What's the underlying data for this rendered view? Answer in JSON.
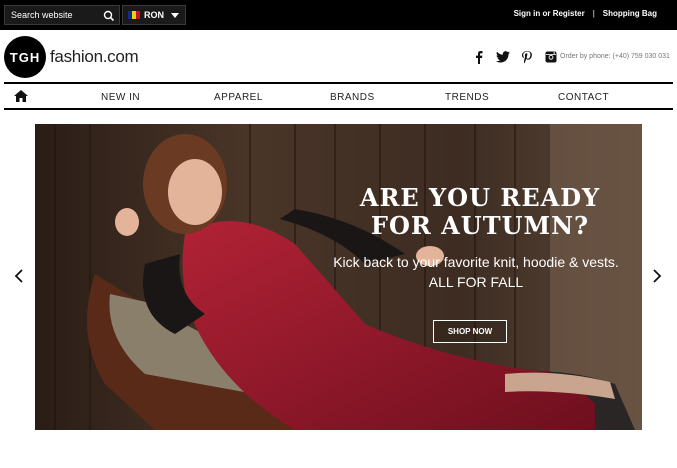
{
  "topbar": {
    "search_placeholder": "Search website",
    "currency": "RON",
    "account_link": "Sign in or Register",
    "separator": "|",
    "bag_link": "Shopping Bag"
  },
  "header": {
    "logo_mark": "TGH",
    "logo_text": "fashion.com",
    "phone": "Order by phone: (+40) 759 030 031",
    "social": [
      "facebook-icon",
      "twitter-icon",
      "pinterest-icon",
      "instagram-icon"
    ]
  },
  "nav": {
    "items": [
      "NEW IN",
      "APPAREL",
      "BRANDS",
      "TRENDS",
      "CONTACT"
    ]
  },
  "hero": {
    "title_line1": "ARE YOU READY",
    "title_line2": "FOR AUTUMN?",
    "subtitle": "Kick back to your favorite knit, hoodie & vests.",
    "tagline": "ALL FOR FALL",
    "button": "SHOP NOW"
  },
  "colors": {
    "topbar": "#000000",
    "dress": "#9b1c2e",
    "accent": "#ffffff"
  }
}
